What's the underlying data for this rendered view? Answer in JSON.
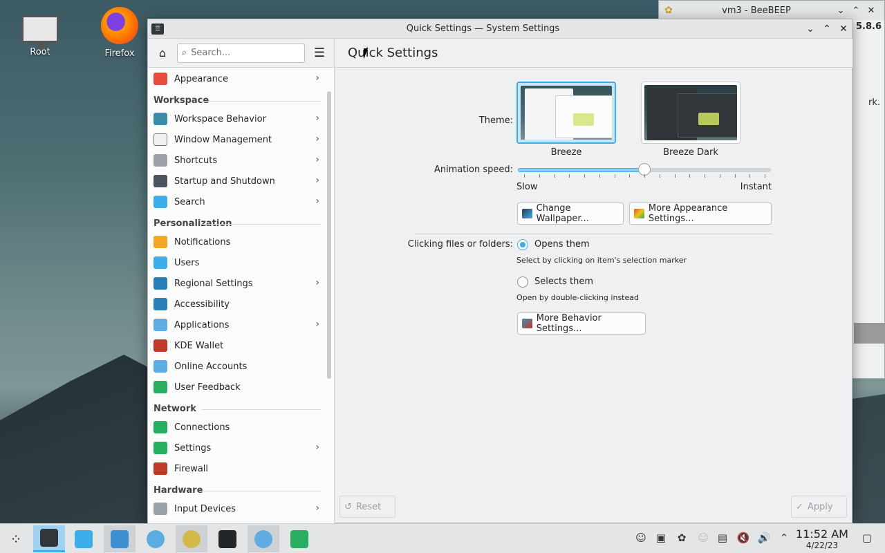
{
  "desktop": {
    "icons": [
      {
        "label": "Root"
      },
      {
        "label": "Firefox"
      }
    ]
  },
  "bee_window": {
    "title": "vm3 - BeeBEEP",
    "version_fragment": "5.8.6",
    "side_text": "rk."
  },
  "window": {
    "title": "Quick Settings — System Settings",
    "minimize_icon": "chevron-down-icon",
    "maximize_icon": "chevron-up-icon",
    "close_icon": "close-icon"
  },
  "sidebar": {
    "search_placeholder": "Search...",
    "items": [
      {
        "label": "Appearance",
        "chevron": true,
        "icon_color": "#e74c3c"
      },
      {
        "section": "Workspace"
      },
      {
        "label": "Workspace Behavior",
        "chevron": true,
        "icon_color": "#3b8eaa"
      },
      {
        "label": "Window Management",
        "chevron": true,
        "icon_color": "#eef0f2"
      },
      {
        "label": "Shortcuts",
        "chevron": true,
        "icon_color": "#9aa0a6"
      },
      {
        "label": "Startup and Shutdown",
        "chevron": true,
        "icon_color": "#4a5560"
      },
      {
        "label": "Search",
        "chevron": true,
        "icon_color": "#3daee9"
      },
      {
        "section": "Personalization"
      },
      {
        "label": "Notifications",
        "chevron": false,
        "icon_color": "#f5a623"
      },
      {
        "label": "Users",
        "chevron": false,
        "icon_color": "#3daee9"
      },
      {
        "label": "Regional Settings",
        "chevron": true,
        "icon_color": "#2980b9"
      },
      {
        "label": "Accessibility",
        "chevron": false,
        "icon_color": "#2980b9"
      },
      {
        "label": "Applications",
        "chevron": true,
        "icon_color": "#5dade2"
      },
      {
        "label": "KDE Wallet",
        "chevron": false,
        "icon_color": "#c0392b"
      },
      {
        "label": "Online Accounts",
        "chevron": false,
        "icon_color": "#5dade2"
      },
      {
        "label": "User Feedback",
        "chevron": false,
        "icon_color": "#27ae60"
      },
      {
        "section": "Network"
      },
      {
        "label": "Connections",
        "chevron": false,
        "icon_color": "#27ae60"
      },
      {
        "label": "Settings",
        "chevron": true,
        "icon_color": "#27ae60"
      },
      {
        "label": "Firewall",
        "chevron": false,
        "icon_color": "#c0392b"
      },
      {
        "section": "Hardware"
      },
      {
        "label": "Input Devices",
        "chevron": true,
        "icon_color": "#9aa0a6"
      }
    ]
  },
  "content": {
    "page_title": "Quick Settings",
    "theme_label": "Theme:",
    "themes": [
      {
        "name": "Breeze",
        "selected": true
      },
      {
        "name": "Breeze Dark",
        "selected": false
      }
    ],
    "animation_label": "Animation speed:",
    "slider_min_label": "Slow",
    "slider_max_label": "Instant",
    "slider_value": 0.5,
    "slider_ticks": 17,
    "change_wallpaper": "Change Wallpaper...",
    "more_appearance": "More Appearance Settings...",
    "click_label": "Clicking files or folders:",
    "opens_them": "Opens them",
    "opens_hint": "Select by clicking on item's selection marker",
    "selects_them": "Selects them",
    "selects_hint": "Open by double-clicking instead",
    "more_behavior": "More Behavior Settings...",
    "reset": "Reset",
    "apply": "Apply"
  },
  "taskbar": {
    "time": "11:52 AM",
    "date": "4/22/23"
  },
  "colors": {
    "accent": "#3daee9",
    "selection": "#93cdee"
  }
}
